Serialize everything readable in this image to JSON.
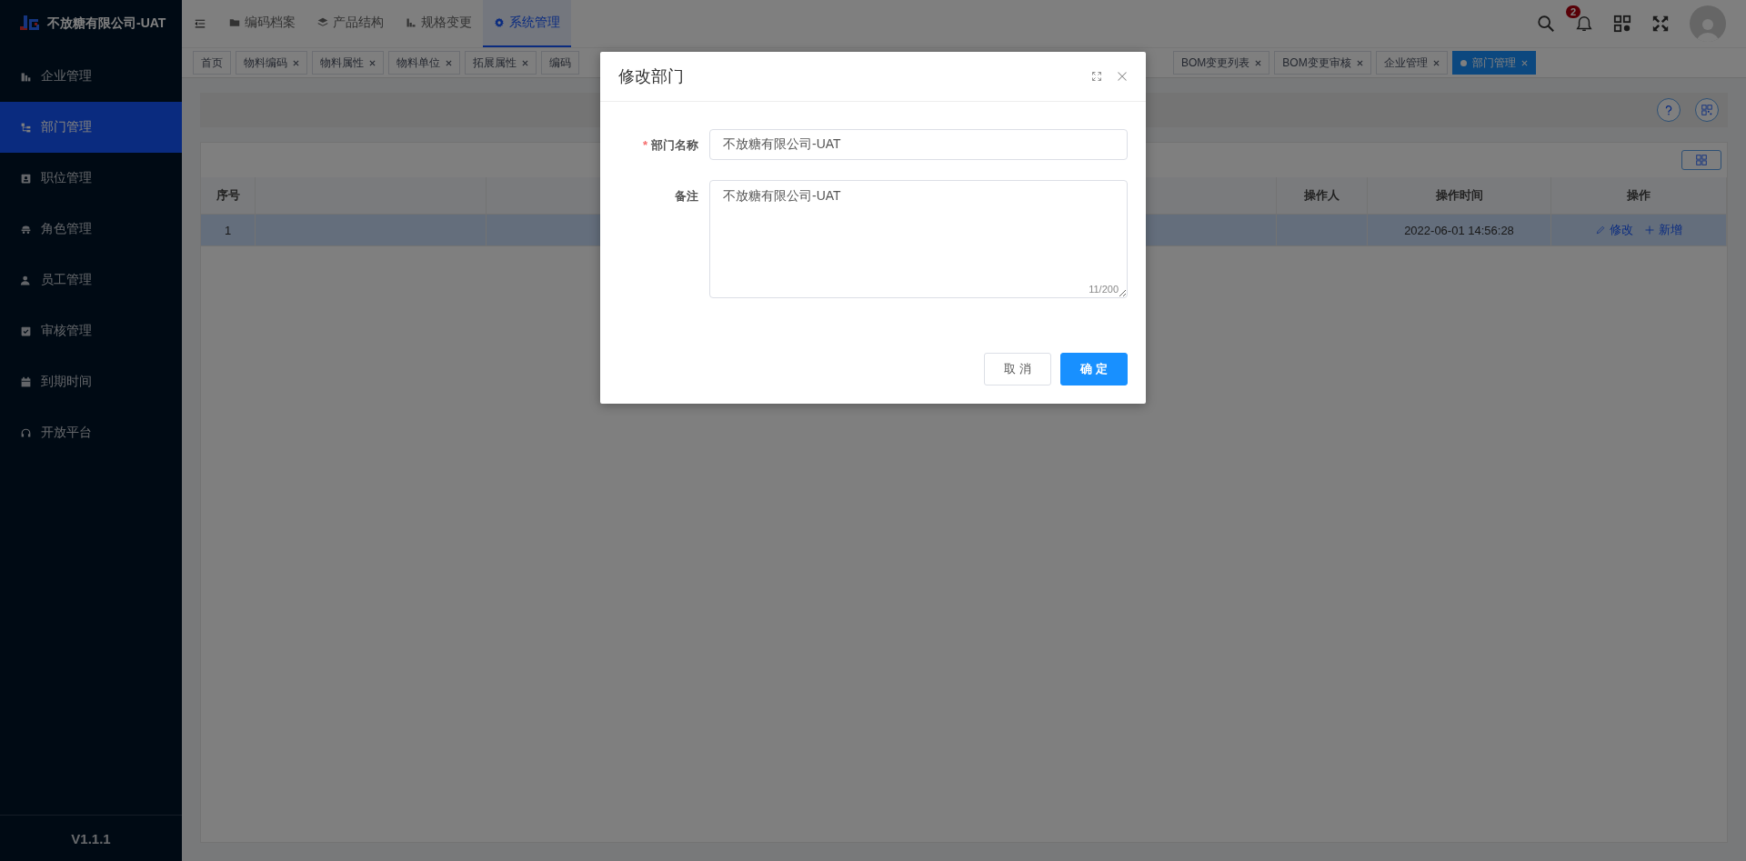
{
  "header": {
    "logo_text": "不放糖有限公司-UAT",
    "nav": [
      {
        "label": "编码档案",
        "selected": false
      },
      {
        "label": "产品结构",
        "selected": false
      },
      {
        "label": "规格变更",
        "selected": false
      },
      {
        "label": "系统管理",
        "selected": true
      }
    ],
    "notification_count": "2"
  },
  "sidebar": {
    "items": [
      {
        "label": "企业管理",
        "selected": false
      },
      {
        "label": "部门管理",
        "selected": true
      },
      {
        "label": "职位管理",
        "selected": false
      },
      {
        "label": "角色管理",
        "selected": false
      },
      {
        "label": "员工管理",
        "selected": false
      },
      {
        "label": "审核管理",
        "selected": false
      },
      {
        "label": "到期时间",
        "selected": false
      },
      {
        "label": "开放平台",
        "selected": false
      }
    ],
    "version": "V1.1.1"
  },
  "tabs_left": [
    {
      "label": "首页",
      "closable": false,
      "selected": false
    },
    {
      "label": "物料编码",
      "closable": true,
      "selected": false
    },
    {
      "label": "物料属性",
      "closable": true,
      "selected": false
    },
    {
      "label": "物料单位",
      "closable": true,
      "selected": false
    },
    {
      "label": "拓展属性",
      "closable": true,
      "selected": false
    },
    {
      "label": "编码",
      "closable": false,
      "selected": false
    }
  ],
  "tabs_right": [
    {
      "label": "BOM变更列表",
      "closable": true,
      "selected": false
    },
    {
      "label": "BOM变更审核",
      "closable": true,
      "selected": false
    },
    {
      "label": "企业管理",
      "closable": true,
      "selected": false
    },
    {
      "label": "部门管理",
      "closable": true,
      "selected": true
    }
  ],
  "table": {
    "columns": [
      "序号",
      "操作人",
      "操作时间",
      "操作"
    ],
    "rows": [
      {
        "index": "1",
        "time": "2022-06-01 14:56:28",
        "actions": [
          "修改",
          "新增"
        ],
        "selected": true
      }
    ]
  },
  "dialog": {
    "title": "修改部门",
    "fields": [
      {
        "kind": "input",
        "label": "部门名称",
        "required_mark": "*",
        "value": "不放糖有限公司-UAT"
      },
      {
        "kind": "textarea",
        "label": "备注",
        "value": "不放糖有限公司-UAT",
        "counter": "11/200"
      }
    ],
    "buttons": [
      {
        "label": "取 消",
        "kind": "default"
      },
      {
        "label": "确 定",
        "kind": "primary"
      }
    ]
  }
}
